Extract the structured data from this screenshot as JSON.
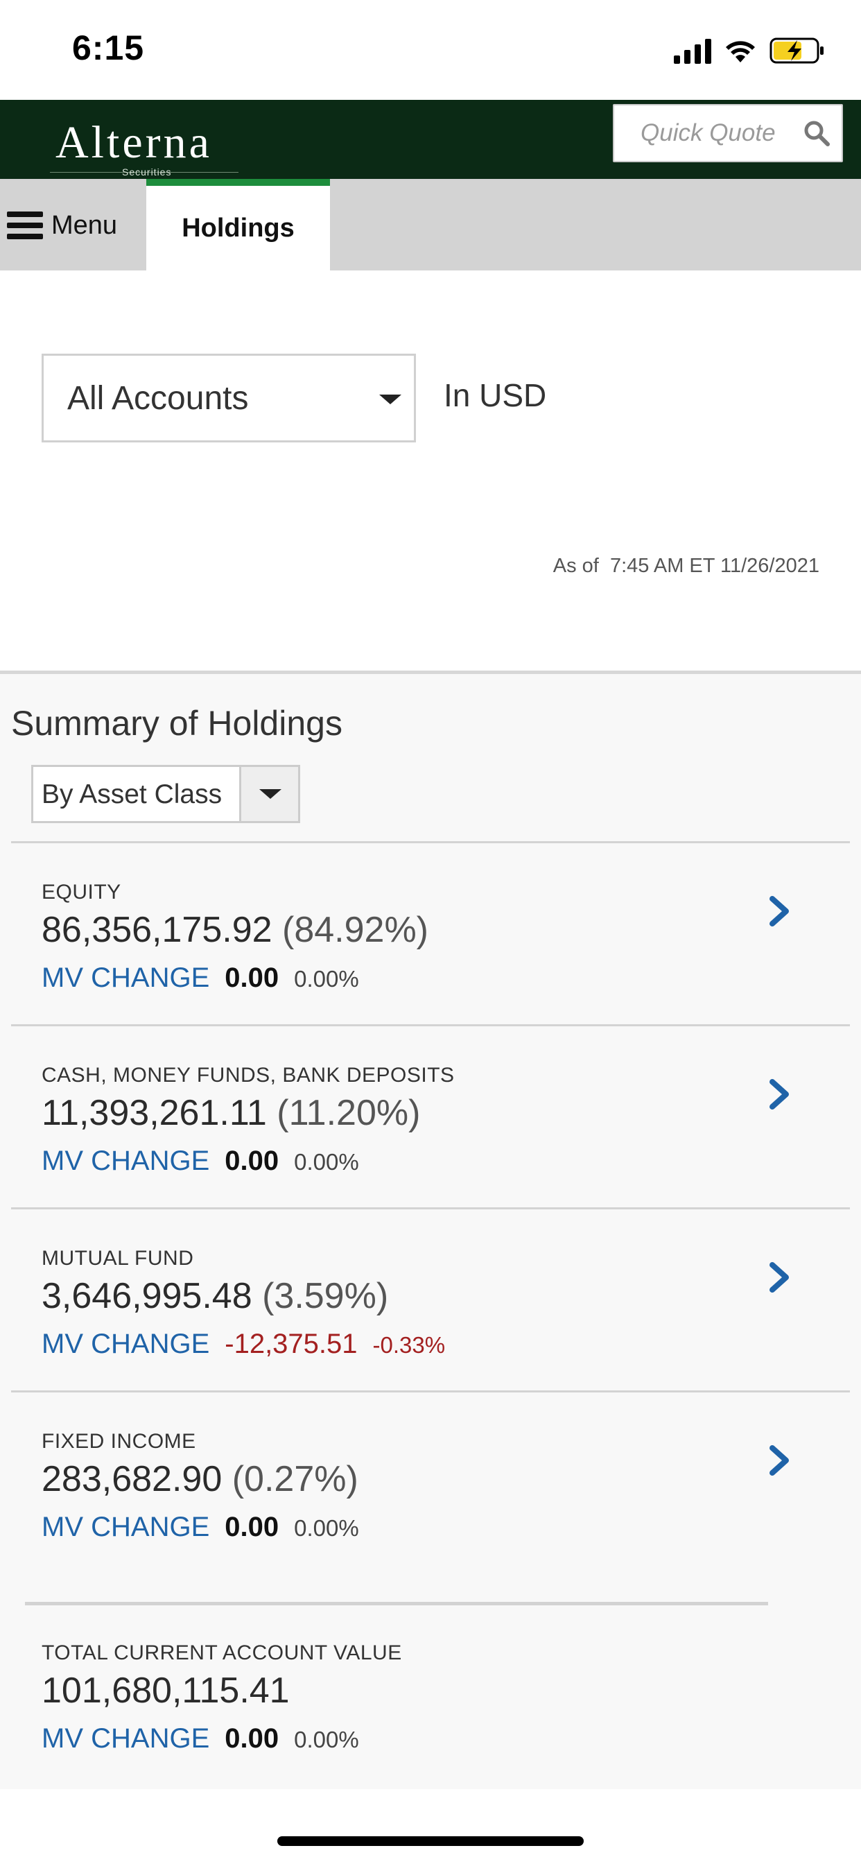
{
  "status_bar": {
    "time": "6:15"
  },
  "header": {
    "brand": "Alterna",
    "brand_sub": "Securities",
    "quick_quote_placeholder": "Quick Quote",
    "colors": {
      "header_bg": "#0b2a15",
      "tab_accent": "#1d8d3c"
    }
  },
  "nav": {
    "menu_label": "Menu",
    "active_tab": "Holdings"
  },
  "filters": {
    "account_selected": "All Accounts",
    "currency": "In USD",
    "as_of": "As of  7:45 AM ET 11/26/2021"
  },
  "summary": {
    "title": "Summary of Holdings",
    "group_by": "By Asset Class",
    "rows": [
      {
        "category": "EQUITY",
        "value": "86,356,175.92",
        "pct": "(84.92%)",
        "mv_label": "MV CHANGE",
        "mv_value": "0.00",
        "mv_pct": "0.00%"
      },
      {
        "category": "CASH, MONEY FUNDS, BANK DEPOSITS",
        "value": "11,393,261.11",
        "pct": "(11.20%)",
        "mv_label": "MV CHANGE",
        "mv_value": "0.00",
        "mv_pct": "0.00%"
      },
      {
        "category": "MUTUAL FUND",
        "value": "3,646,995.48",
        "pct": "(3.59%)",
        "mv_label": "MV CHANGE",
        "mv_value": "-12,375.51",
        "mv_pct": "-0.33%"
      },
      {
        "category": "FIXED INCOME",
        "value": "283,682.90",
        "pct": "(0.27%)",
        "mv_label": "MV CHANGE",
        "mv_value": "0.00",
        "mv_pct": "0.00%"
      }
    ],
    "total": {
      "label": "TOTAL CURRENT ACCOUNT VALUE",
      "value": "101,680,115.41",
      "mv_label": "MV CHANGE",
      "mv_value": "0.00",
      "mv_pct": "0.00%"
    },
    "colors": {
      "mv_label": "#1f63a8",
      "negative": "#a32020"
    }
  }
}
